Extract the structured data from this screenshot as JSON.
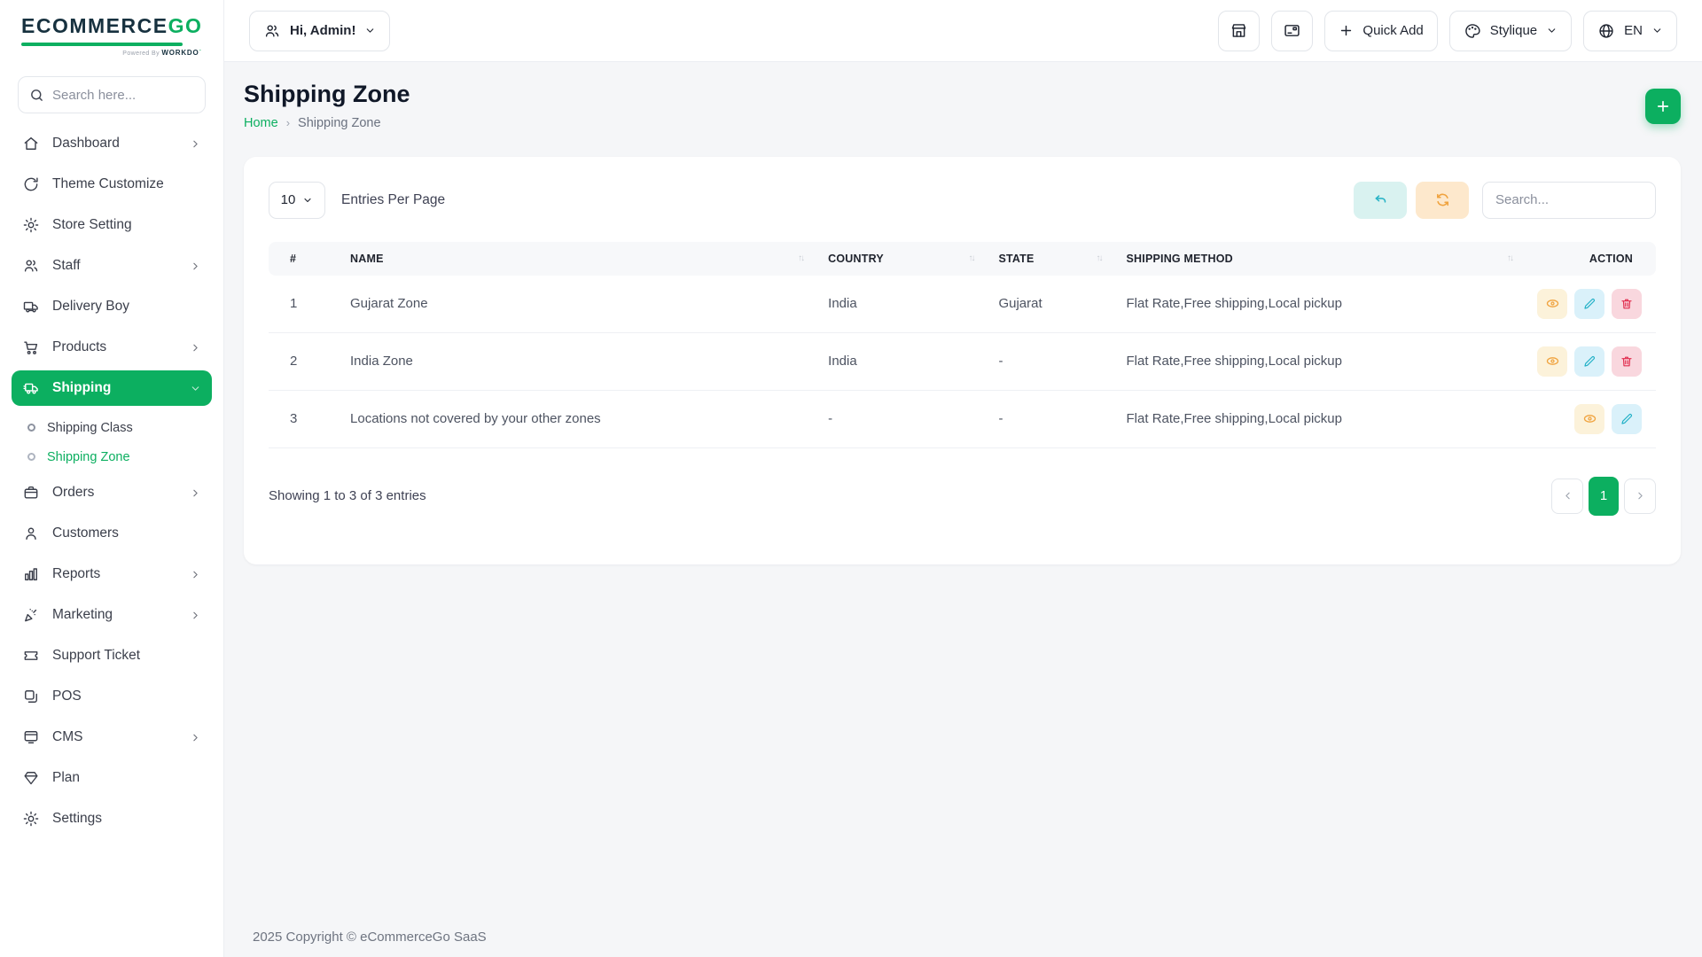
{
  "brand": {
    "logo_part1": "ECO",
    "logo_part2": "MMERCE",
    "logo_part3": "GO",
    "powered_by": "Powered By",
    "powered_brand": "WORKDO"
  },
  "colors": {
    "accent_green": "#0caf60",
    "view_icon": "#f0a33f",
    "edit_icon": "#23b1c7",
    "delete_icon": "#e12d4e",
    "undo_btn_bg": "#d9f2f0",
    "reload_btn_bg": "#fde8cc"
  },
  "sidebar": {
    "search_placeholder": "Search here...",
    "items": [
      {
        "label": "Dashboard",
        "icon": "home-icon",
        "has_chevron": true
      },
      {
        "label": "Theme Customize",
        "icon": "theme-refresh-icon",
        "has_chevron": false
      },
      {
        "label": "Store Setting",
        "icon": "gear-icon",
        "has_chevron": false
      },
      {
        "label": "Staff",
        "icon": "users-icon",
        "has_chevron": true
      },
      {
        "label": "Delivery Boy",
        "icon": "truck-icon",
        "has_chevron": false
      },
      {
        "label": "Products",
        "icon": "cart-icon",
        "has_chevron": true
      },
      {
        "label": "Shipping",
        "icon": "shipping-truck-icon",
        "has_chevron": true,
        "active": true
      },
      {
        "label": "Orders",
        "icon": "briefcase-icon",
        "has_chevron": true
      },
      {
        "label": "Customers",
        "icon": "person-icon",
        "has_chevron": false
      },
      {
        "label": "Reports",
        "icon": "bar-chart-icon",
        "has_chevron": true
      },
      {
        "label": "Marketing",
        "icon": "party-popper-icon",
        "has_chevron": true
      },
      {
        "label": "Support Ticket",
        "icon": "ticket-icon",
        "has_chevron": false
      },
      {
        "label": "POS",
        "icon": "pos-icon",
        "has_chevron": false
      },
      {
        "label": "CMS",
        "icon": "cms-icon",
        "has_chevron": true
      },
      {
        "label": "Plan",
        "icon": "gem-icon",
        "has_chevron": false
      },
      {
        "label": "Settings",
        "icon": "gear-icon",
        "has_chevron": false
      }
    ],
    "shipping_submenu": [
      {
        "label": "Shipping Class",
        "active": false
      },
      {
        "label": "Shipping Zone",
        "active": true
      }
    ]
  },
  "header": {
    "greeting": "Hi, Admin!",
    "quick_add_label": "Quick Add",
    "theme_label": "Stylique",
    "language_label": "EN"
  },
  "page": {
    "title": "Shipping Zone",
    "breadcrumb_home": "Home",
    "breadcrumb_current": "Shipping Zone"
  },
  "toolbar": {
    "entries_value": "10",
    "entries_label": "Entries Per Page",
    "search_placeholder": "Search..."
  },
  "table": {
    "headers": {
      "num": "#",
      "name": "NAME",
      "country": "COUNTRY",
      "state": "STATE",
      "method": "SHIPPING METHOD",
      "action": "ACTION"
    },
    "rows": [
      {
        "num": "1",
        "name": "Gujarat Zone",
        "country": "India",
        "state": "Gujarat",
        "method": "Flat Rate,Free shipping,Local pickup"
      },
      {
        "num": "2",
        "name": "India Zone",
        "country": "India",
        "state": "-",
        "method": "Flat Rate,Free shipping,Local pickup"
      },
      {
        "num": "3",
        "name": "Locations not covered by your other zones",
        "country": "-",
        "state": "-",
        "method": "Flat Rate,Free shipping,Local pickup"
      }
    ],
    "summary": "Showing 1 to 3 of 3 entries",
    "active_page": "1"
  },
  "footer": {
    "copyright": "2025 Copyright © eCommerceGo SaaS"
  }
}
